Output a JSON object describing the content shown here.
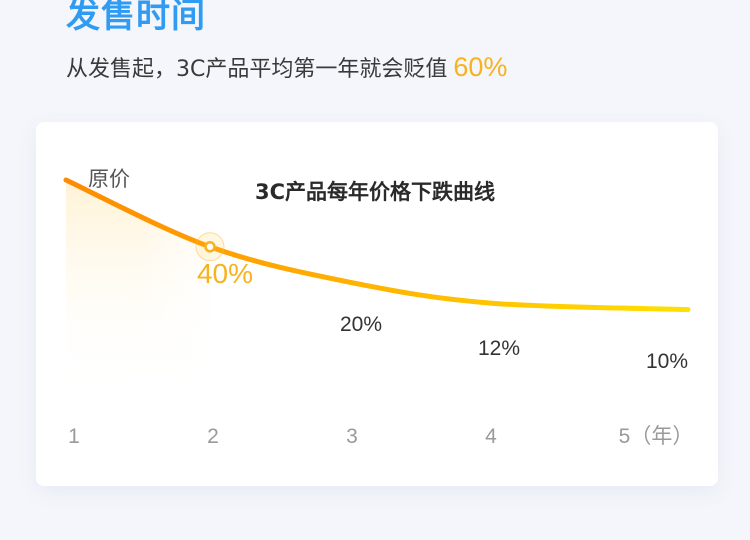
{
  "header": {
    "title": "发售时间",
    "subtitle_text": "从发售起，3C产品平均第一年就会贬值",
    "subtitle_highlight": "60%"
  },
  "colors": {
    "title": "#2f9bf2",
    "highlight": "#f7b21e",
    "line_start": "#ff8a00",
    "line_end": "#ffe000",
    "fill": "#fff3d6",
    "axis_text": "#9a9a9a"
  },
  "chart_data": {
    "type": "line",
    "title": "3C产品每年价格下跌曲线",
    "series_label": "原价",
    "x": [
      1,
      2,
      3,
      4,
      5
    ],
    "x_tick_labels": [
      "1",
      "2",
      "3",
      "4",
      "5（年）"
    ],
    "values": [
      100,
      40,
      20,
      12,
      10
    ],
    "data_labels": [
      "",
      "40%",
      "20%",
      "12%",
      "10%"
    ],
    "highlight_point_index": 1,
    "ylim": [
      0,
      100
    ],
    "grid": false,
    "legend": "none"
  }
}
